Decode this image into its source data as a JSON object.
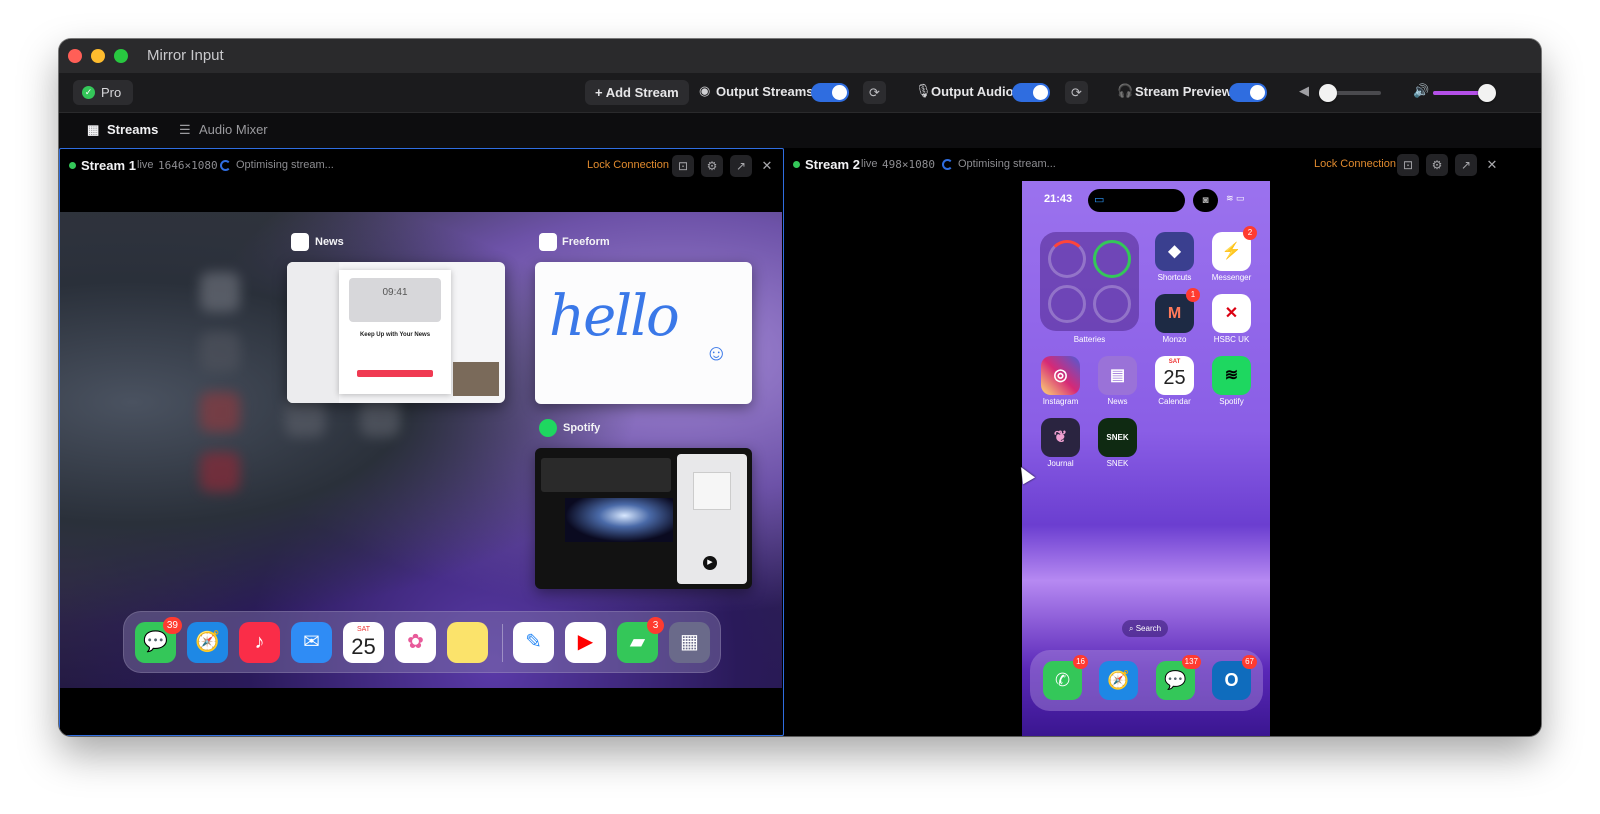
{
  "window": {
    "title": "Mirror Input"
  },
  "toolbar": {
    "pro_label": "Pro",
    "add_stream_label": "+ Add Stream",
    "output_streams_label": "Output Streams",
    "output_streams_on": true,
    "output_audio_label": "Output Audio",
    "output_audio_on": true,
    "stream_preview_label": "Stream Preview",
    "stream_preview_on": true,
    "volume_left_level": 0.0,
    "volume_right_level": 0.9
  },
  "tabs": [
    {
      "label": "Streams",
      "active": true,
      "icon": "grid-icon"
    },
    {
      "label": "Audio Mixer",
      "active": false,
      "icon": "sliders-icon"
    }
  ],
  "streams": [
    {
      "name": "Stream 1",
      "live_label": "live",
      "resolution": "1646×1080",
      "status": "Optimising stream...",
      "lock_label": "Lock Connection",
      "device": {
        "app_cards": [
          {
            "title": "News",
            "content_heading": "Keep Up with Your News",
            "content_time": "09:41"
          },
          {
            "title": "Freeform",
            "content_text": "hello"
          },
          {
            "title": "Spotify"
          }
        ],
        "dock": [
          {
            "icon": "messages-icon",
            "badge": "39",
            "color": "#34c759",
            "glyph": "💬"
          },
          {
            "icon": "safari-icon",
            "badge": "",
            "color": "#1e88e5",
            "glyph": "🧭"
          },
          {
            "icon": "music-icon",
            "badge": "",
            "color": "#fa2d48",
            "glyph": "♪"
          },
          {
            "icon": "mail-icon",
            "badge": "",
            "color": "#2f8cf5",
            "glyph": "✉"
          },
          {
            "icon": "calendar-icon",
            "badge": "",
            "color": "#ffffff",
            "glyph": "",
            "day": "SAT",
            "date": "25"
          },
          {
            "icon": "photos-icon",
            "badge": "",
            "color": "#ffffff",
            "glyph": "✿"
          },
          {
            "icon": "notes-icon",
            "badge": "",
            "color": "#fbe36b",
            "glyph": ""
          },
          {
            "icon": "freeform-icon",
            "badge": "",
            "color": "#ffffff",
            "glyph": "✎"
          },
          {
            "icon": "youtube-icon",
            "badge": "",
            "color": "#ffffff",
            "glyph": "▶"
          },
          {
            "icon": "facetime-icon",
            "badge": "3",
            "color": "#34c759",
            "glyph": "▰"
          },
          {
            "icon": "app-library-icon",
            "badge": "",
            "color": "#6a6a8a",
            "glyph": "▦"
          }
        ]
      }
    },
    {
      "name": "Stream 2",
      "live_label": "live",
      "resolution": "498×1080",
      "status": "Optimising stream...",
      "lock_label": "Lock Connection",
      "device": {
        "time": "21:43",
        "widget_label": "Batteries",
        "apps": [
          {
            "label": "Shortcuts",
            "badge": "",
            "icon": "shortcuts-icon",
            "color": "#3a3f8f",
            "glyph": "◆"
          },
          {
            "label": "Messenger",
            "badge": "2",
            "icon": "messenger-icon",
            "color": "#ffffff",
            "glyph": "⚡"
          },
          {
            "label": "Monzo",
            "badge": "1",
            "icon": "monzo-icon",
            "color": "#1d2a44",
            "glyph": "M"
          },
          {
            "label": "HSBC UK",
            "badge": "",
            "icon": "hsbc-icon",
            "color": "#ffffff",
            "glyph": "✕"
          },
          {
            "label": "Instagram",
            "badge": "",
            "icon": "instagram-icon",
            "color": "#e1306c",
            "glyph": "◎"
          },
          {
            "label": "News",
            "badge": "",
            "icon": "news-folder-icon",
            "color": "#9a72d8",
            "glyph": "▤"
          },
          {
            "label": "Calendar",
            "badge": "",
            "icon": "calendar-icon",
            "color": "#ffffff",
            "glyph": "",
            "day": "SAT",
            "date": "25"
          },
          {
            "label": "Spotify",
            "badge": "",
            "icon": "spotify-icon",
            "color": "#1ed760",
            "glyph": "≋"
          },
          {
            "label": "Journal",
            "badge": "",
            "icon": "journal-icon",
            "color": "#2a2440",
            "glyph": "❦"
          },
          {
            "label": "SNEK",
            "badge": "",
            "icon": "snek-icon",
            "color": "#0f2a12",
            "glyph": "SNEK"
          }
        ],
        "search_label": "Search",
        "dock": [
          {
            "icon": "phone-icon",
            "badge": "16",
            "color": "#34c759",
            "glyph": "✆"
          },
          {
            "icon": "safari-icon",
            "badge": "",
            "color": "#1e88e5",
            "glyph": "🧭"
          },
          {
            "icon": "messages-icon",
            "badge": "137",
            "color": "#34c759",
            "glyph": "💬"
          },
          {
            "icon": "outlook-icon",
            "badge": "67",
            "color": "#0f6cbd",
            "glyph": "O"
          }
        ]
      }
    }
  ]
}
